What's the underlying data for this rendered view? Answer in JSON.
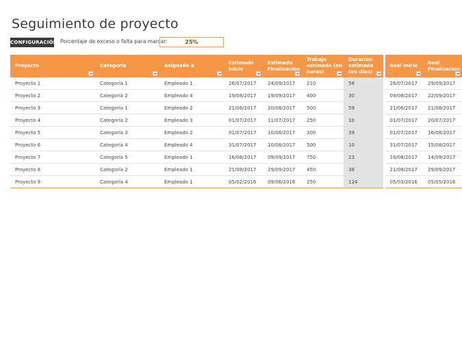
{
  "page": {
    "title": "Seguimiento de proyecto"
  },
  "config": {
    "button_label": "CONFIGURACIÓN",
    "percent_label": "Porcentaje de exceso o falta para marcar:",
    "percent_value": "25%"
  },
  "table": {
    "headers": [
      "Proyecto",
      "Categoría",
      "Asignado a",
      "Estimado Inicio",
      "Estimado Finalización",
      "Trabajo estimado (en horas)",
      "Duración estimada (en días)",
      "Real Inicio",
      "Real Finalización"
    ],
    "rows": [
      [
        "Proyecto 1",
        "Categoría 1",
        "Empleado 1",
        "26/07/2017",
        "24/09/2017",
        "210",
        "58",
        "26/07/2017",
        "29/09/2017"
      ],
      [
        "Proyecto 2",
        "Categoría 2",
        "Empleado 4",
        "19/08/2017",
        "19/09/2017",
        "400",
        "30",
        "09/08/2017",
        "22/09/2017"
      ],
      [
        "Proyecto 3",
        "Categoría 1",
        "Empleado 2",
        "21/06/2017",
        "20/08/2017",
        "500",
        "59",
        "21/06/2017",
        "21/08/2017"
      ],
      [
        "Proyecto 4",
        "Categoría 2",
        "Empleado 3",
        "01/07/2017",
        "11/07/2017",
        "250",
        "10",
        "01/07/2017",
        "20/07/2017"
      ],
      [
        "Proyecto 5",
        "Categoría 3",
        "Empleado 2",
        "01/07/2017",
        "10/08/2017",
        "300",
        "39",
        "01/07/2017",
        "16/08/2017"
      ],
      [
        "Proyecto 6",
        "Categoría 4",
        "Empleado 4",
        "31/07/2017",
        "10/08/2017",
        "500",
        "10",
        "31/07/2017",
        "15/08/2017"
      ],
      [
        "Proyecto 7",
        "Categoría 5",
        "Empleado 1",
        "16/08/2017",
        "09/09/2017",
        "750",
        "23",
        "16/08/2017",
        "14/09/2017"
      ],
      [
        "Proyecto 8",
        "Categoría 2",
        "Empleado 1",
        "21/08/2017",
        "29/09/2017",
        "450",
        "38",
        "21/08/2017",
        "29/09/2017"
      ],
      [
        "Proyecto 9",
        "Categoría 4",
        "Empleado 1",
        "05/02/2016",
        "09/06/2016",
        "250",
        "124",
        "05/03/2016",
        "05/05/2016"
      ]
    ]
  },
  "colors": {
    "accent": "#f79646",
    "header_text": "#ffffff",
    "shaded_column": "#e3e3e3",
    "button_bg": "#3b3b3b"
  }
}
